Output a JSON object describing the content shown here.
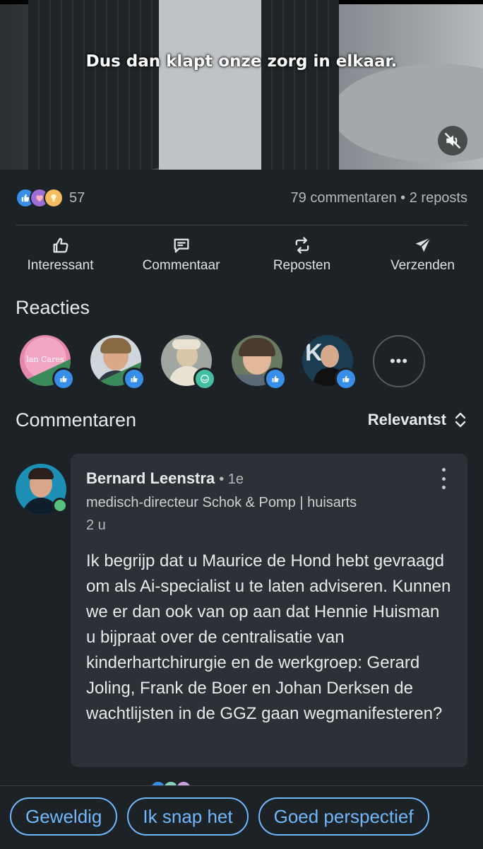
{
  "video": {
    "caption": "Dus dan klapt onze zorg in elkaar.",
    "mute_icon": "muted-speaker-icon"
  },
  "social": {
    "reaction_icons": [
      "like-icon",
      "love-icon",
      "insightful-icon"
    ],
    "reaction_count": "57",
    "comment_stats": "79 commentaren • 2 reposts"
  },
  "actions": [
    {
      "label": "Interessant",
      "icon": "thumbs-up-icon"
    },
    {
      "label": "Commentaar",
      "icon": "comment-icon"
    },
    {
      "label": "Reposten",
      "icon": "repost-icon"
    },
    {
      "label": "Verzenden",
      "icon": "send-icon"
    }
  ],
  "reactions": {
    "title": "Reacties",
    "avatars": [
      {
        "badge": "like",
        "text": "lan Cares"
      },
      {
        "badge": "like"
      },
      {
        "badge": "funny"
      },
      {
        "badge": "like"
      },
      {
        "badge": "like"
      }
    ],
    "more_label": "•••"
  },
  "comments": {
    "title": "Commentaren",
    "sort_label": "Relevantst",
    "items": [
      {
        "name": "Bernard Leenstra",
        "degree": "• 1e",
        "headline": "medisch-directeur Schok & Pomp | huisarts",
        "time": "2 u",
        "text": "Ik begrijp dat u Maurice de Hond hebt gevraagd om als Ai-specialist u te laten adviseren. Kunnen we er dan ook van op aan dat Hennie Huisman u bijpraat over de centralisatie van kinderhartchirurgie en de werkgroep: Gerard Joling, Frank de Boer en Johan Derksen de wachtlijsten in de GGZ gaan wegmanifesteren?"
      }
    ]
  },
  "suggestions": [
    "Geweldig",
    "Ik snap het",
    "Goed perspectief"
  ],
  "colors": {
    "background": "#1d2226",
    "bubble": "#2b3137",
    "chip_accent": "#71b7fb",
    "like_blue": "#378fe9",
    "online_green": "#57c27d"
  }
}
